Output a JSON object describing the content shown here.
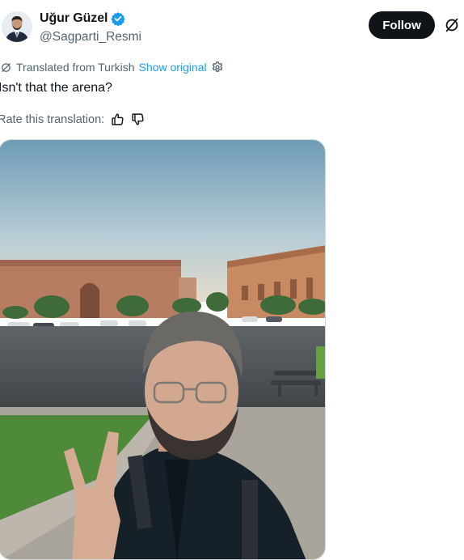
{
  "author": {
    "display_name": "Uğur Güzel",
    "handle": "@Sagparti_Resmi",
    "verified": true,
    "verified_color": "#1d9bf0"
  },
  "actions": {
    "follow_label": "Follow"
  },
  "translation": {
    "note": "Translated from Turkish",
    "show_original_label": "Show original",
    "tweet_text": "Isn't that the arena?",
    "rate_label": "Rate this translation:"
  },
  "colors": {
    "accent": "#1d9bf0",
    "text": "#0f1419",
    "muted": "#536471"
  },
  "icons": {
    "verified": "verified-badge-icon",
    "grok": "grok-icon",
    "translate": "grok-icon",
    "settings": "gear-icon",
    "thumbs_up": "thumbs-up-icon",
    "thumbs_down": "thumbs-down-icon"
  }
}
